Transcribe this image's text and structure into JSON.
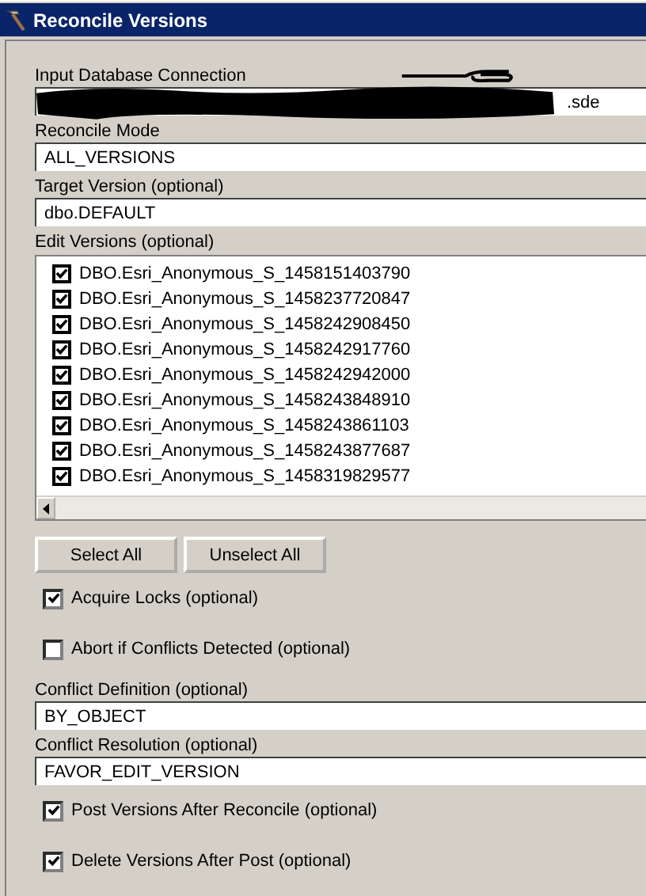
{
  "window": {
    "title": "Reconcile Versions"
  },
  "input_database_connection": {
    "label": "Input Database Connection",
    "value": ".sde",
    "redacted": true
  },
  "reconcile_mode": {
    "label": "Reconcile Mode",
    "value": "ALL_VERSIONS"
  },
  "target_version": {
    "label": "Target Version (optional)",
    "value": "dbo.DEFAULT"
  },
  "edit_versions": {
    "label": "Edit Versions (optional)",
    "items": [
      {
        "label": "DBO.Esri_Anonymous_S_1458151403790",
        "checked": true
      },
      {
        "label": "DBO.Esri_Anonymous_S_1458237720847",
        "checked": true
      },
      {
        "label": "DBO.Esri_Anonymous_S_1458242908450",
        "checked": true
      },
      {
        "label": "DBO.Esri_Anonymous_S_1458242917760",
        "checked": true
      },
      {
        "label": "DBO.Esri_Anonymous_S_1458242942000",
        "checked": true
      },
      {
        "label": "DBO.Esri_Anonymous_S_1458243848910",
        "checked": true
      },
      {
        "label": "DBO.Esri_Anonymous_S_1458243861103",
        "checked": true
      },
      {
        "label": "DBO.Esri_Anonymous_S_1458243877687",
        "checked": true
      },
      {
        "label": "DBO.Esri_Anonymous_S_1458319829577",
        "checked": true
      }
    ]
  },
  "buttons": [
    "Select All",
    "Unselect All"
  ],
  "options_top": [
    {
      "label": "Acquire Locks (optional)",
      "checked": true
    },
    {
      "label": "Abort if Conflicts Detected (optional)",
      "checked": false
    }
  ],
  "conflict_definition": {
    "label": "Conflict Definition (optional)",
    "value": "BY_OBJECT"
  },
  "conflict_resolution": {
    "label": "Conflict Resolution (optional)",
    "value": "FAVOR_EDIT_VERSION"
  },
  "options_bottom": [
    {
      "label": "Post Versions After Reconcile (optional)",
      "checked": true
    },
    {
      "label": "Delete Versions After Post (optional)",
      "checked": true
    }
  ]
}
